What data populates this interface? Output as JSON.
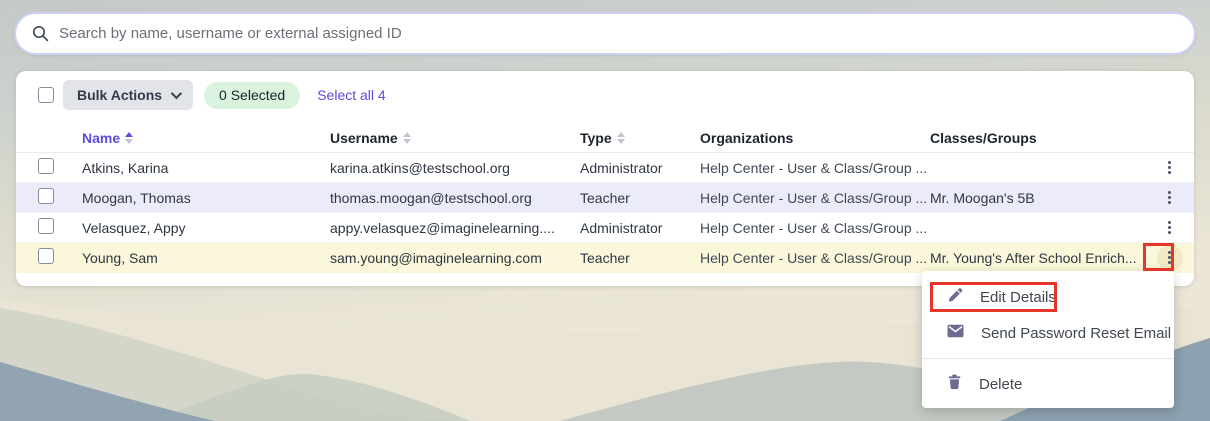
{
  "colors": {
    "accent_purple": "#5b4ce0",
    "badge_green_bg": "#d9f3de",
    "row_highlight_lavender": "#ecebf9",
    "row_highlight_yellow": "#fbf7da",
    "annotation_red": "#e8352b",
    "menu_icon_color": "#6c6c90"
  },
  "search": {
    "placeholder": "Search by name, username or external assigned ID",
    "value": "",
    "icon": "search-icon"
  },
  "toolbar": {
    "bulk_actions_label": "Bulk Actions",
    "selected_badge": "0 Selected",
    "select_all_label": "Select all 4"
  },
  "table": {
    "columns": [
      {
        "label": "Name",
        "sort": "asc"
      },
      {
        "label": "Username",
        "sort": "unsorted"
      },
      {
        "label": "Type",
        "sort": "unsorted"
      },
      {
        "label": "Organizations",
        "sort": "none"
      },
      {
        "label": "Classes/Groups",
        "sort": "none"
      }
    ],
    "rows": [
      {
        "name": "Atkins, Karina",
        "username": "karina.atkins@testschool.org",
        "type": "Administrator",
        "organizations": "Help Center - User & Class/Group ...",
        "classes_groups": "",
        "highlight": "none",
        "menu_open": false
      },
      {
        "name": "Moogan, Thomas",
        "username": "thomas.moogan@testschool.org",
        "type": "Teacher",
        "organizations": "Help Center - User & Class/Group ...",
        "classes_groups": "Mr. Moogan's 5B",
        "highlight": "lavender",
        "menu_open": false
      },
      {
        "name": "Velasquez, Appy",
        "username": "appy.velasquez@imaginelearning....",
        "type": "Administrator",
        "organizations": "Help Center - User & Class/Group ...",
        "classes_groups": "",
        "highlight": "none",
        "menu_open": false
      },
      {
        "name": "Young, Sam",
        "username": "sam.young@imaginelearning.com",
        "type": "Teacher",
        "organizations": "Help Center - User & Class/Group ...",
        "classes_groups": "Mr. Young's After School Enrich...",
        "highlight": "yellow",
        "menu_open": true
      }
    ]
  },
  "context_menu": {
    "items": [
      {
        "label": "Edit Details",
        "icon": "pencil-icon",
        "annotated": true,
        "divider_before": false
      },
      {
        "label": "Send Password Reset Email",
        "icon": "envelope-icon",
        "annotated": false,
        "divider_before": false
      },
      {
        "label": "Delete",
        "icon": "trash-icon",
        "annotated": false,
        "divider_before": true
      }
    ]
  },
  "annotations": {
    "boxes": [
      {
        "target": "row-4 kebab menu icon"
      },
      {
        "target": "Edit Details menu item"
      }
    ]
  }
}
